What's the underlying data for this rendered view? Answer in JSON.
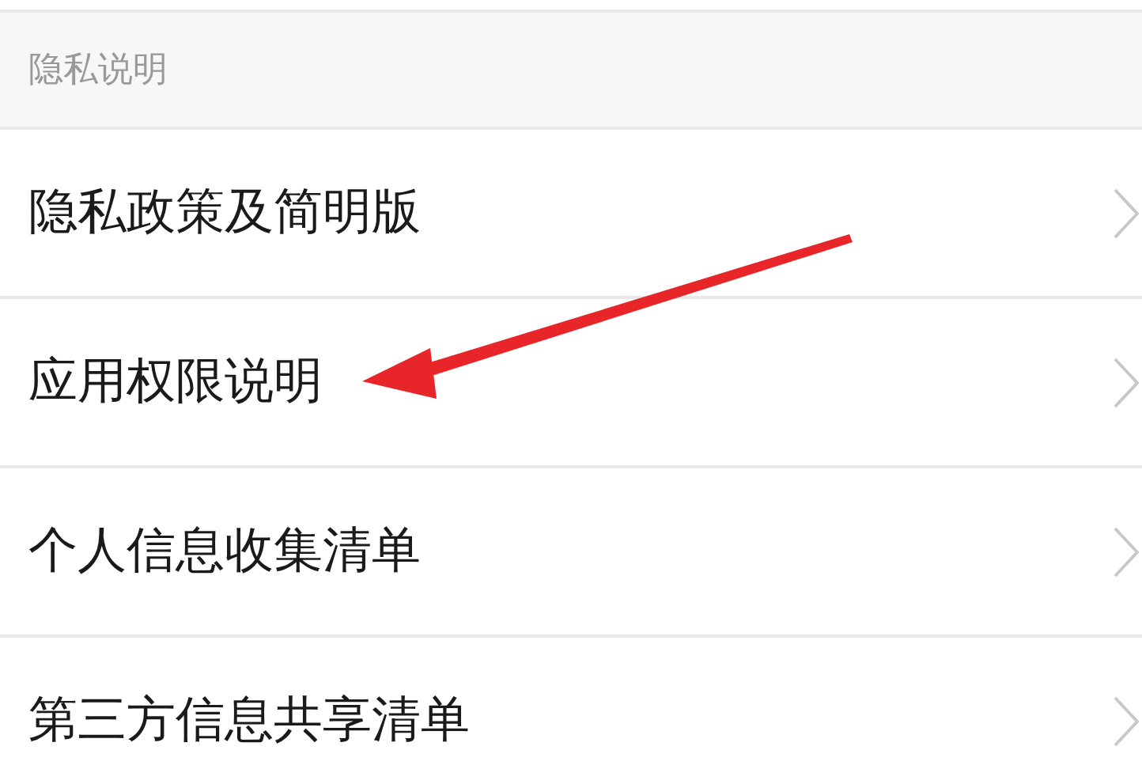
{
  "section_header": "隐私说明",
  "items": [
    {
      "label": "隐私政策及简明版"
    },
    {
      "label": "应用权限说明"
    },
    {
      "label": "个人信息收集清单"
    },
    {
      "label": "第三方信息共享清单"
    }
  ]
}
